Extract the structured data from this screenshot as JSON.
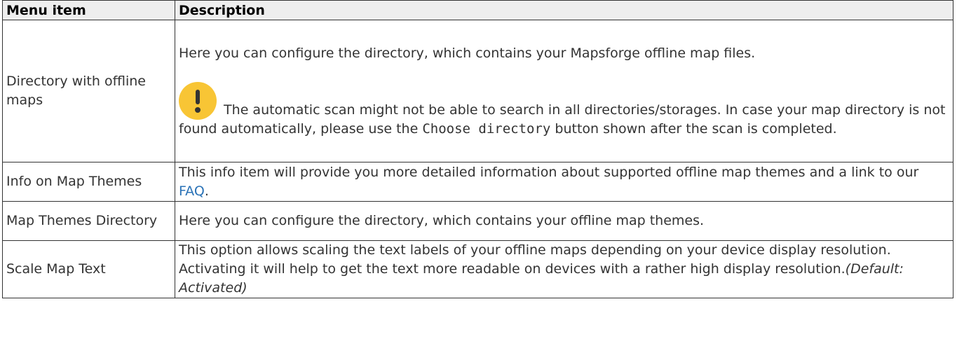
{
  "table": {
    "headers": {
      "menu_item": "Menu item",
      "description": "Description"
    },
    "rows": {
      "directory": {
        "item": "Directory with offline maps",
        "description": "Here you can configure the directory, which contains your Mapsforge offline map files.",
        "note": {
          "icon": "exclamation-icon",
          "text_before": "The automatic scan might not be able to search in all directories/storages. In case your map directory is not found automatically, please use the",
          "code": "Choose directory",
          "text_after": "button shown after the scan is completed."
        }
      },
      "info_themes": {
        "item": "Info on Map Themes",
        "description_before": "This info item will provide you more detailed information about supported offline map themes and a link to our",
        "link": "FAQ",
        "description_after": "."
      },
      "themes_directory": {
        "item": "Map Themes Directory",
        "description": "Here you can configure the directory, which contains your offline map themes."
      },
      "scale_text": {
        "item": "Scale Map Text",
        "description": "This option allows scaling the text labels of your offline maps depending on your device display resolution. Activating it will help to get the text more readable on devices with a rather high display resolution.",
        "default_note": "(Default: Activated)"
      }
    }
  },
  "colors": {
    "header_bg": "#eeeeee",
    "border": "#333333",
    "link": "#2b73b7",
    "note_icon": "#f8c535"
  }
}
